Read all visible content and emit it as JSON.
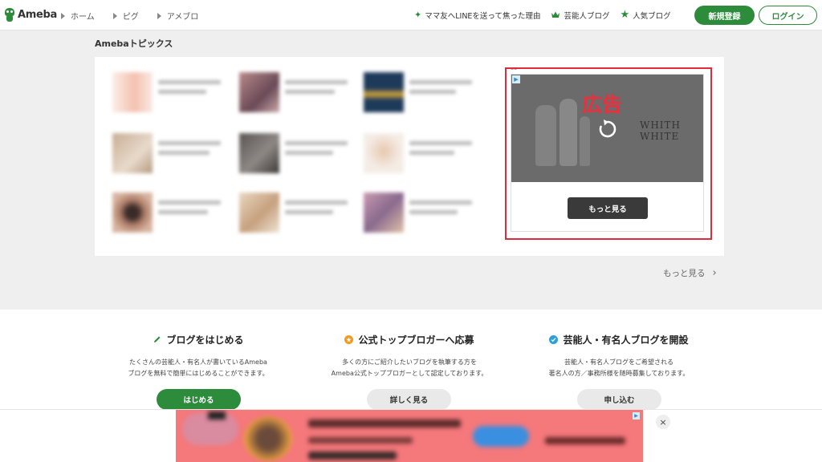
{
  "header": {
    "logo_text": "Ameba",
    "breadcrumbs": [
      "ホーム",
      "ピグ",
      "アメブロ"
    ],
    "nav": [
      {
        "icon": "sparkle-icon",
        "label": "ママ友へLINEを送って焦った理由"
      },
      {
        "icon": "crown-icon",
        "label": "芸能人ブログ"
      },
      {
        "icon": "star-icon",
        "label": "人気ブログ"
      }
    ],
    "signup_label": "新規登録",
    "login_label": "ログイン"
  },
  "topics": {
    "title": "Amebaトピックス",
    "more_label": "もっと見る"
  },
  "ad": {
    "label": "広告",
    "brand_line1": "WHITH",
    "brand_line2": "WHITE",
    "more_button": "もっと見る"
  },
  "promo": [
    {
      "title": "ブログをはじめる",
      "desc_line1": "たくさんの芸能人・有名人が書いているAmeba",
      "desc_line2": "ブログを無料で簡単にはじめることができます。",
      "button": "はじめる"
    },
    {
      "title": "公式トップブロガーへ応募",
      "desc_line1": "多くの方にご紹介したいブログを執筆する方を",
      "desc_line2": "Ameba公式トップブロガーとして認定しております。",
      "button": "詳しく見る"
    },
    {
      "title": "芸能人・有名人ブログを開設",
      "desc_line1": "芸能人・有名人ブログをご希望される",
      "desc_line2": "著名人の方／事務所様を随時募集しております。",
      "button": "申し込む"
    }
  ],
  "banner": {
    "close": "×"
  },
  "colors": {
    "brand_green": "#2d8c3c",
    "ad_highlight": "#e02b3c",
    "ad_label": "#e8303e"
  }
}
